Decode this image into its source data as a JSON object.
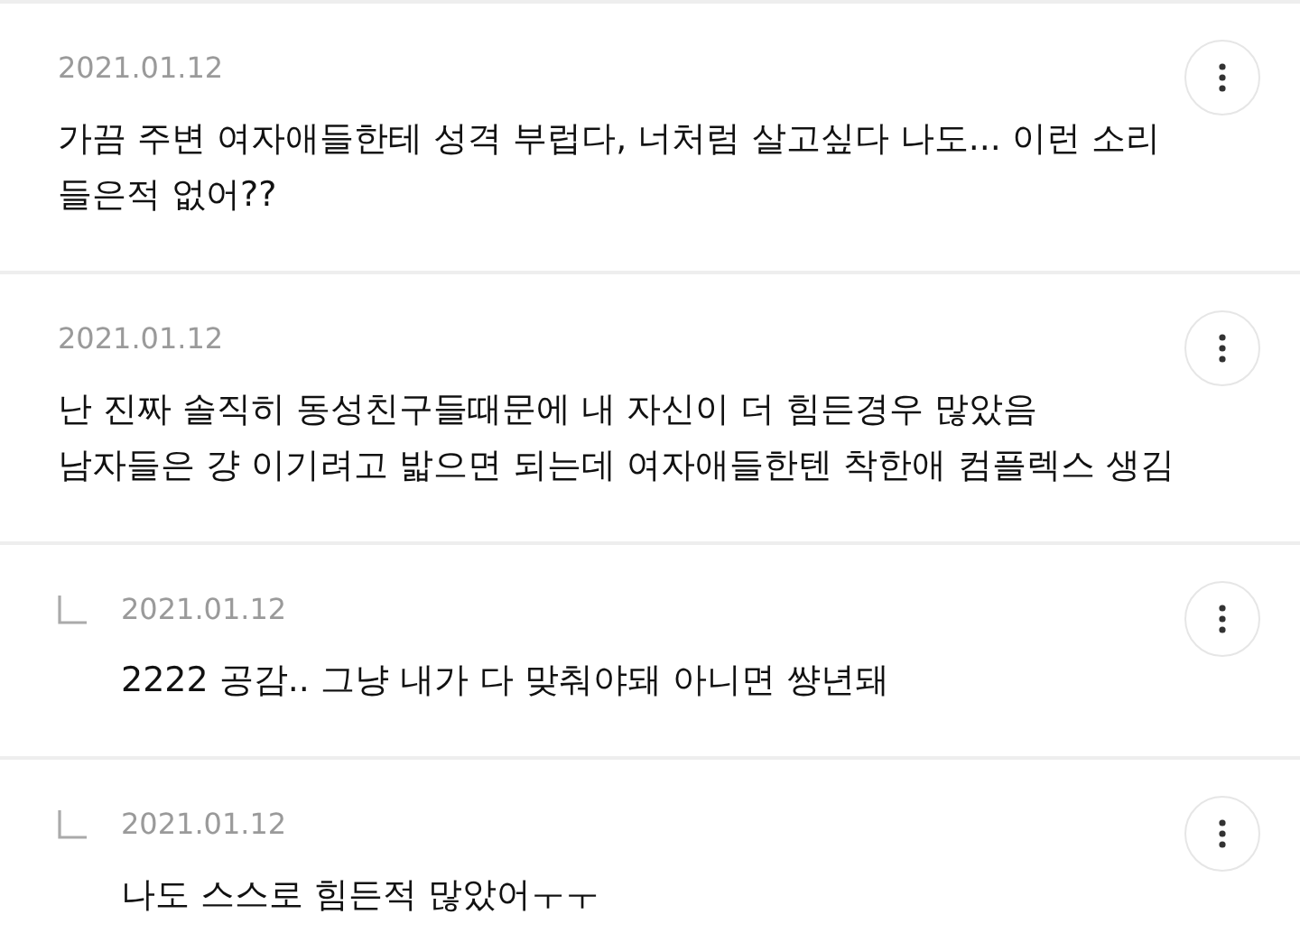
{
  "comments": [
    {
      "kind": "comment",
      "date": "2021.01.12",
      "text": "가끔 주변 여자애들한테 성격 부럽다, 너처럼 살고싶다 나도... 이런 소리\n들은적 없어??"
    },
    {
      "kind": "comment",
      "date": "2021.01.12",
      "text": "난 진짜 솔직히 동성친구들때문에 내 자신이 더 힘든경우 많았음\n남자들은 걍 이기려고 밟으면 되는데 여자애들한텐 착한애 컴플렉스 생김"
    },
    {
      "kind": "reply",
      "date": "2021.01.12",
      "text": "2222 공감.. 그냥 내가 다 맞춰야돼 아니면 썅년돼"
    },
    {
      "kind": "reply",
      "date": "2021.01.12",
      "text": "나도 스스로 힘든적 많았어ㅜㅜ"
    }
  ]
}
